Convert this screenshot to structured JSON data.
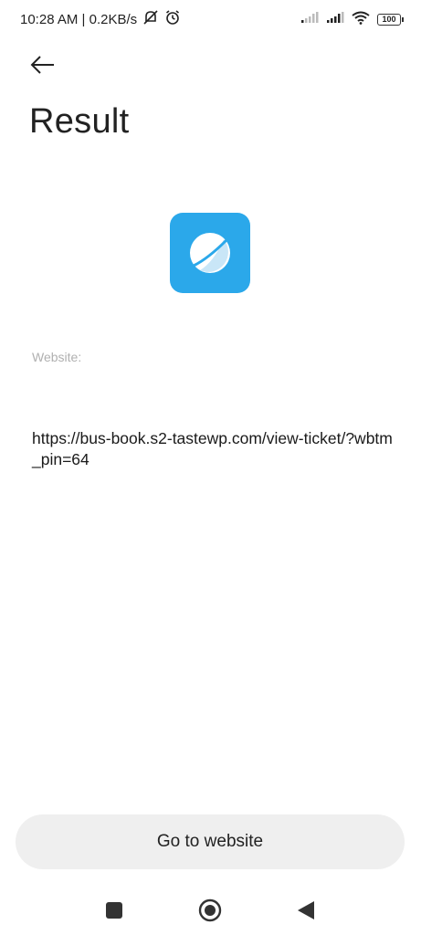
{
  "status_bar": {
    "time_speed": "10:28 AM | 0.2KB/s",
    "battery": "100"
  },
  "header": {
    "title": "Result"
  },
  "result": {
    "field_label": "Website:",
    "url": "https://bus-book.s2-tastewp.com/view-ticket/?wbtm_pin=64"
  },
  "actions": {
    "go_label": "Go to website"
  },
  "colors": {
    "accent": "#2ba8ea",
    "button_bg": "#efefef"
  },
  "icons": {
    "app": "browser-icon",
    "back": "back-arrow-icon",
    "nav": [
      "recent-apps-icon",
      "home-icon",
      "back-triangle-icon"
    ]
  }
}
